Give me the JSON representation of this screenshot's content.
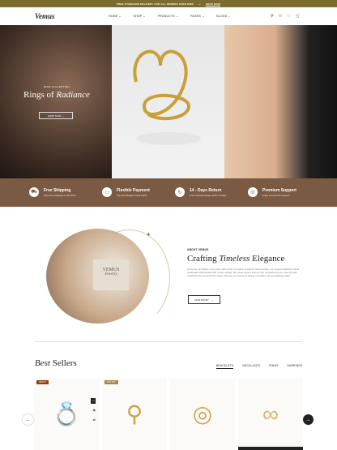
{
  "topbar": {
    "text": "FREE STANDARD DELIVERY FOR ALL ORDERS OVER $380",
    "link": "SHOP NOW"
  },
  "header": {
    "logo": "Vemus",
    "nav": [
      "HOME",
      "SHOP",
      "PRODUCTS",
      "PAGES",
      "BLOGS"
    ]
  },
  "hero": {
    "subtitle": "RING COLLECTION",
    "title_a": "Rings of ",
    "title_b": "Radiance",
    "button": "SHOP NOW"
  },
  "features": [
    {
      "title": "Free Shipping",
      "sub": "Enjoy free shipping on all orders",
      "icon": "truck-icon"
    },
    {
      "title": "Flexible Payment",
      "sub": "Pay with Multiple Credit Cards",
      "icon": "card-icon"
    },
    {
      "title": "14 - Days Return",
      "sub": "Free return/exchange within 14 days",
      "icon": "return-icon"
    },
    {
      "title": "Premium Support",
      "sub": "Enjoy our premium support",
      "icon": "support-icon"
    }
  ],
  "about": {
    "box_brand": "VEMUS",
    "box_sub": "Jewelry",
    "subtitle": "ABOUT VEMUS",
    "title_a": "Crafting ",
    "title_b": "Timeless",
    "title_c": " Elegance",
    "body": "At Vemus, we believe every piece tells a story. Founded on passion and precision, our curated collections blend traditional craftsmanship with modern design. We create jewelry that not only complements your style but also celebrates the moments that matter. Discover our journey of beauty, innovation, and everlasting quality.",
    "button": "OUR STORY"
  },
  "bestsellers": {
    "title_a": "Best",
    "title_b": " Sellers",
    "tabs": [
      "BRACELETS",
      "NECKLACES",
      "RINGS",
      "EARRINGS"
    ],
    "cards": [
      {
        "badge": "NEW IN",
        "badge_color": "#9a3d12",
        "glyph": "💍"
      },
      {
        "badge": "20% OFF",
        "badge_color": "#a8864a",
        "glyph": "⚲"
      },
      {
        "badge": "",
        "glyph": "◎"
      },
      {
        "badge": "",
        "glyph": "∞"
      }
    ]
  }
}
